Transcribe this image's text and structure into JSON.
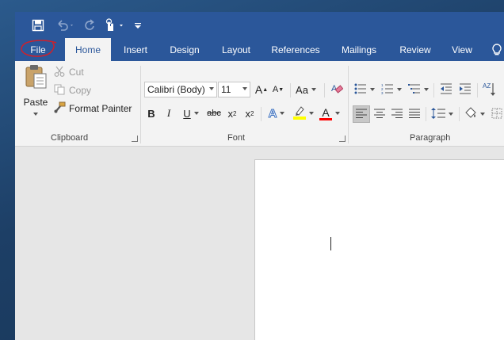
{
  "quick_access": {
    "save_icon": "save-icon",
    "undo_icon": "undo-icon",
    "redo_icon": "redo-icon",
    "touch_mode_icon": "touch-mode-icon",
    "customize_icon": "customize-qat-icon"
  },
  "tabs": [
    "File",
    "Home",
    "Insert",
    "Design",
    "Layout",
    "References",
    "Mailings",
    "Review",
    "View"
  ],
  "active_tab": "Home",
  "clipboard": {
    "paste_label": "Paste",
    "cut_label": "Cut",
    "copy_label": "Copy",
    "format_painter_label": "Format Painter",
    "group_label": "Clipboard"
  },
  "font": {
    "font_name": "Calibri (Body)",
    "font_size": "11",
    "bold": "B",
    "italic": "I",
    "underline": "U",
    "strikethrough": "abc",
    "subscript": "x",
    "subscript_mark": "2",
    "superscript": "x",
    "superscript_mark": "2",
    "grow": "A",
    "shrink": "A",
    "change_case": "Aa",
    "text_effects": "A",
    "font_color": "A",
    "group_label": "Font"
  },
  "paragraph": {
    "sort_label": "AZ",
    "group_label": "Paragraph"
  },
  "colors": {
    "accent": "#2b579a",
    "highlight": "#ffff00",
    "font_color": "#ff0000",
    "annotation": "#d0202a"
  }
}
